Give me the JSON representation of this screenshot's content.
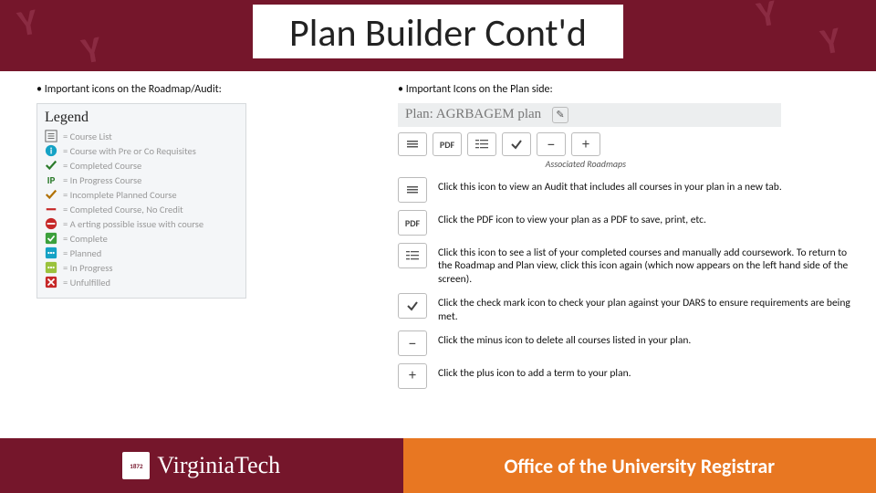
{
  "title": "Plan Builder Cont'd",
  "left": {
    "heading": "Important icons on the Roadmap/Audit:",
    "legend_title": "Legend",
    "items": {
      "course_list": "= Course List",
      "prereq": "= Course with Pre or Co Requisites",
      "completed": "= Completed Course",
      "ip_label": "IP",
      "in_progress": "= In Progress Course",
      "incomplete_planned": "= Incomplete Planned Course",
      "no_credit": "= Completed Course, No Credit",
      "possible_issue": "= A erting possible issue with course",
      "complete": "= Complete",
      "planned": "= Planned",
      "in_progress2": "= In Progress",
      "unfulfilled": "= Unfulfilled"
    }
  },
  "right": {
    "heading": "Important Icons on the Plan side:",
    "plan_label": "Plan: AGRBAGEM plan",
    "assoc": "Associated Roadmaps",
    "pdf_label": "PDF",
    "desc": {
      "audit": "Click this icon to view an Audit that includes all courses in your plan in a new tab.",
      "pdf": "Click the PDF icon to view your plan as a PDF to save, print, etc.",
      "completed": "Click this icon to see a list of your completed courses and manually add coursework. To return to the Roadmap and Plan view, click this icon again (which now appears on the left hand side of the screen).",
      "check": "Click the check mark icon to check your plan against your DARS to ensure requirements are being met.",
      "minus": "Click the minus icon to delete all courses listed in your plan.",
      "plus": "Click the plus icon to add a term to your plan."
    }
  },
  "footer": {
    "brand": "VirginiaTech",
    "shield": "1872",
    "registrar": "Office of the University Registrar"
  }
}
